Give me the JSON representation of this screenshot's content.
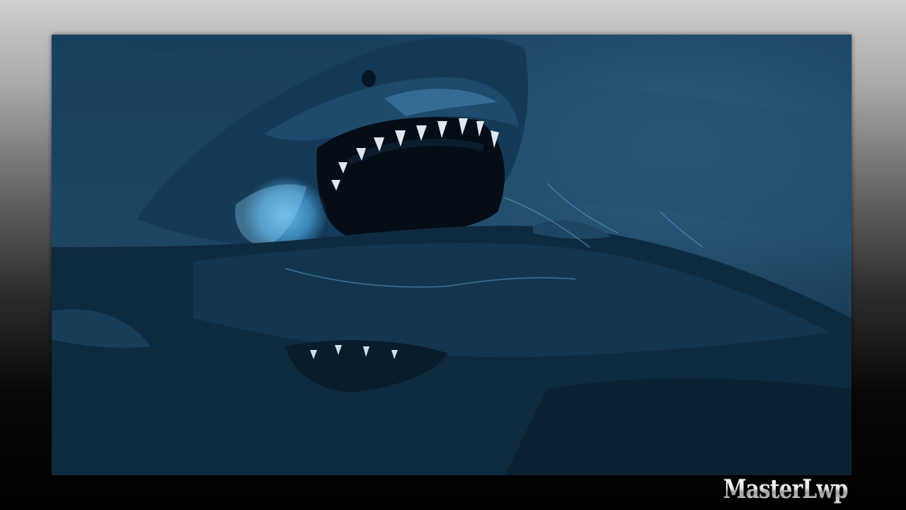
{
  "watermark": {
    "text": "MasterLwp"
  },
  "scene": {
    "subject": "shark-icon",
    "colors": {
      "water_light": "#2a5678",
      "water_mid": "#1b3f5c",
      "water_dark": "#0b2234",
      "highlight": "#5fb6e8",
      "teeth": "#dfe8ee"
    }
  }
}
